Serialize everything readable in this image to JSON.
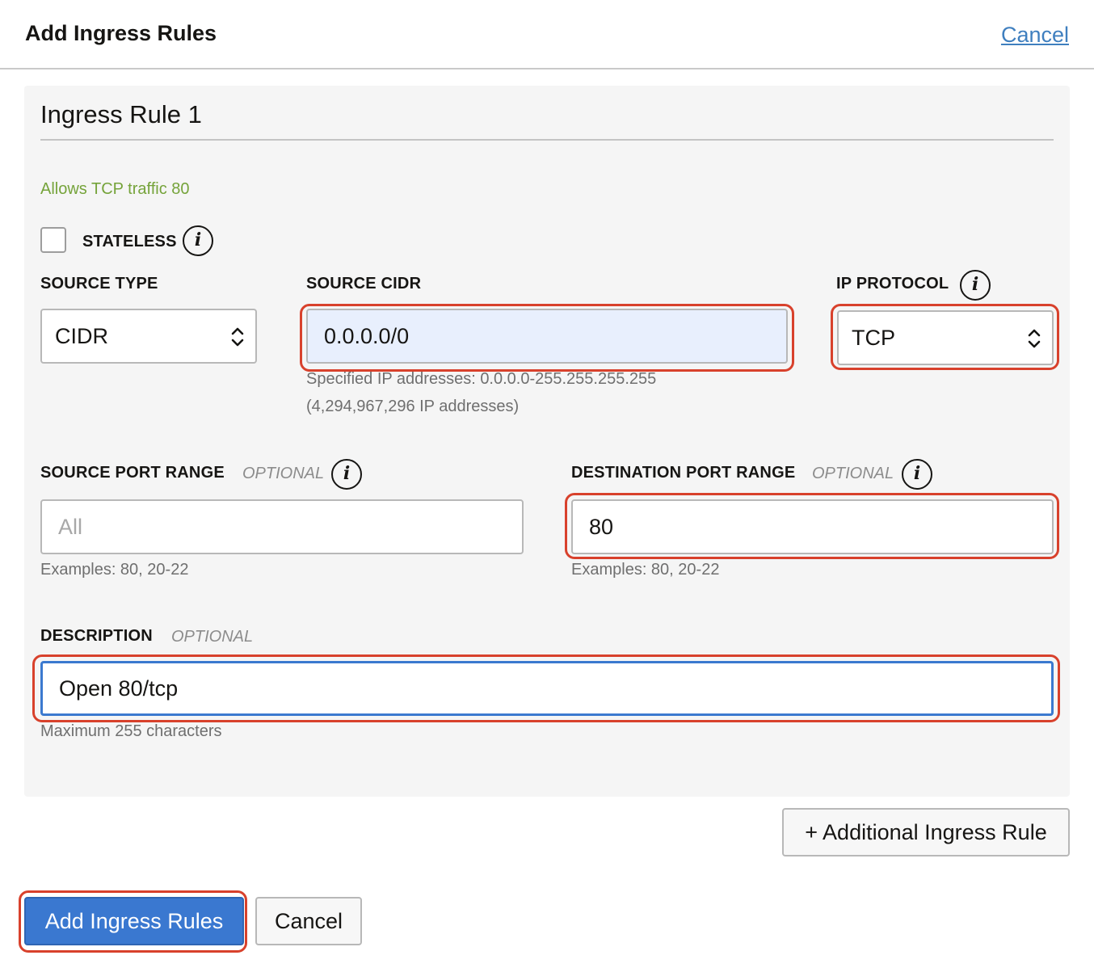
{
  "header": {
    "title": "Add Ingress Rules",
    "cancel_link": "Cancel"
  },
  "rule": {
    "title": "Ingress Rule 1",
    "summary": "Allows TCP traffic 80",
    "stateless": {
      "label": "STATELESS",
      "checked": false,
      "info_icon": "i"
    },
    "source_type": {
      "label": "SOURCE TYPE",
      "value": "CIDR"
    },
    "source_cidr": {
      "label": "SOURCE CIDR",
      "value": "0.0.0.0/0",
      "hint_line1": "Specified IP addresses: 0.0.0.0-255.255.255.255",
      "hint_line2": "(4,294,967,296 IP addresses)"
    },
    "ip_protocol": {
      "label": "IP PROTOCOL",
      "value": "TCP",
      "info_icon": "i"
    },
    "source_port_range": {
      "label": "SOURCE PORT RANGE",
      "optional": "OPTIONAL",
      "placeholder": "All",
      "hint": "Examples: 80, 20-22",
      "info_icon": "i"
    },
    "destination_port_range": {
      "label": "DESTINATION PORT RANGE",
      "optional": "OPTIONAL",
      "value": "80",
      "hint": "Examples: 80, 20-22",
      "info_icon": "i"
    },
    "description": {
      "label": "DESCRIPTION",
      "optional": "OPTIONAL",
      "value": "Open 80/tcp",
      "hint": "Maximum 255 characters"
    }
  },
  "actions": {
    "additional_rule": "+ Additional Ingress Rule",
    "submit": "Add Ingress Rules",
    "cancel": "Cancel"
  },
  "colors": {
    "accent": "#3a78d0",
    "highlight": "#d8412c",
    "summary_green": "#75a33a",
    "link": "#3f7fbf"
  }
}
